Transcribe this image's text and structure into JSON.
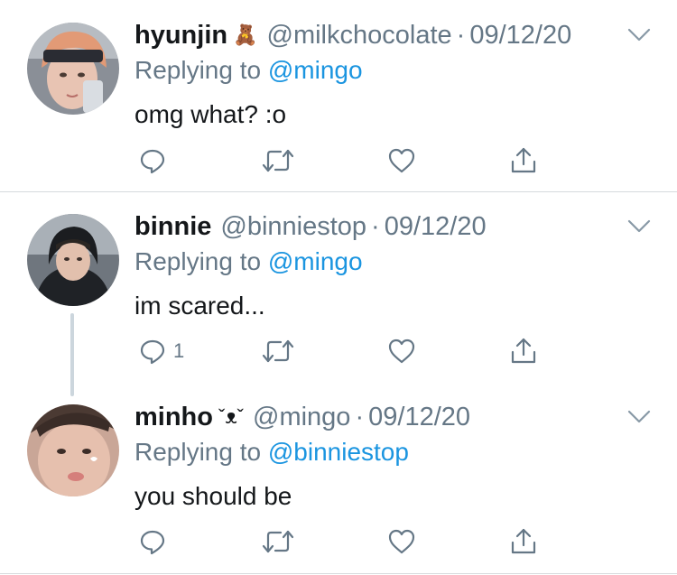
{
  "tweets": [
    {
      "name": "hyunjin",
      "decoration": "🧸",
      "handle": "@milkchocolate",
      "date": "09/12/20",
      "replying_prefix": "Replying to",
      "replying_to": "@mingo",
      "text": "omg what? :o",
      "reply_count": ""
    },
    {
      "name": "binnie",
      "decoration": "",
      "handle": "@binniestop",
      "date": "09/12/20",
      "replying_prefix": "Replying to",
      "replying_to": "@mingo",
      "text": "im scared...",
      "reply_count": "1"
    },
    {
      "name": "minho",
      "decoration": "ˇᴥˇ",
      "handle": "@mingo",
      "date": "09/12/20",
      "replying_prefix": "Replying to",
      "replying_to": "@binniestop",
      "text": "you should be",
      "reply_count": ""
    }
  ],
  "separator": "·",
  "icons": [
    "reply-icon",
    "retweet-icon",
    "like-icon",
    "share-icon",
    "chevron-down-icon"
  ],
  "colors": {
    "name": "#14171a",
    "secondary": "#657786",
    "link": "#1b95e0",
    "divider": "#d6dadd",
    "thread": "#ccd6dd"
  }
}
